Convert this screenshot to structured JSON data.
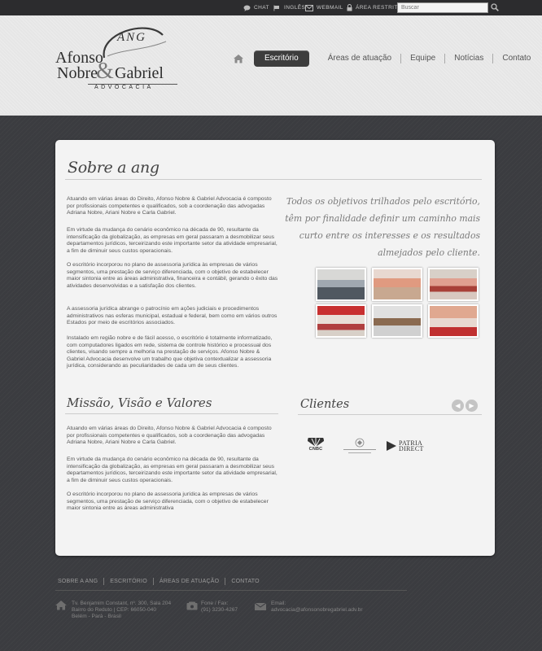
{
  "topbar": {
    "chat": "CHAT",
    "ingles": "INGLÊS",
    "webmail": "WEBMAIL",
    "area_restrita": "ÁREA RESTRITA",
    "search_placeholder": "Buscar"
  },
  "logo": {
    "mark": "ANG",
    "line1": "Afonso",
    "line2": "Nobre",
    "amp": "&",
    "line3": "Gabriel",
    "tagline": "ADVOCACIA"
  },
  "nav": {
    "items": [
      "Escritório",
      "Áreas de atuação",
      "Equipe",
      "Notícias",
      "Contato"
    ]
  },
  "about": {
    "title": "Sobre a ang",
    "paragraphs": [
      "Atuando em várias áreas do Direito, Afonso Nobre & Gabriel Advocacia é composto por profissionais competentes e qualificados, sob a coordenação das advogadas Adriana Nobre, Ariani Nobre e Carla Gabriel.",
      "Em virtude da mudança do cenário econômico na década de 90, resultante da intensificação da globalização, as empresas em geral passaram a desmobilizar seus departamentos jurídicos, terceirizando este importante setor da atividade empresarial, a fim de diminuir seus custos operacionais.",
      "O escritório incorporou no plano de assessoria jurídica às empresas de vários segmentos, uma prestação de serviço diferenciada, com o objetivo de estabelecer maior sintonia entre as áreas administrativa, financeira e contábil, gerando o êxito das atividades desenvolvidas e a satisfação dos clientes.",
      "A assessoria jurídica abrange o patrocínio em ações judiciais e procedimentos administrativos nas esferas municipal, estadual e federal, bem como em vários outros Estados por meio de escritórios associados.",
      "Instalado em região nobre e de fácil acesso, o escritório é totalmente informatizado, com computadores ligados em rede, sistema de controle histórico e processual dos clientes, visando sempre a melhoria na prestação de serviços. Afonso Nobre & Gabriel Advocacia desenvolve um trabalho que objetiva contextualizar a assessoria jurídica, considerando as peculiaridades de cada um de seus clientes."
    ],
    "quote": "Todos os objetivos trilhados pelo escritório, têm por finalidade definir um caminho mais curto entre os interesses e os resultados almejados pelo cliente."
  },
  "mvv": {
    "title": "Missão, Visão e Valores",
    "paragraphs": [
      "Atuando em várias áreas do Direito, Afonso Nobre & Gabriel Advocacia é composto por profissionais competentes e qualificados, sob a coordenação das advogadas Adriana Nobre, Ariani Nobre e Carla Gabriel.",
      "Em virtude da mudança do cenário econômico na década de 90, resultante da intensificação da globalização, as empresas em geral passaram a desmobilizar seus departamentos jurídicos, terceirizando este importante setor da atividade empresarial, a fim de diminuir seus custos operacionais.",
      "O escritório incorporou no plano de assessoria jurídica às empresas de vários segmentos, uma prestação de serviço diferenciada, com o objetivo de estabelecer maior sintonia entre as áreas administrativa"
    ]
  },
  "clients": {
    "title": "Clientes",
    "logos": [
      "CNBC",
      "PATRIA",
      "DIRECT"
    ]
  },
  "footer": {
    "nav": [
      "SOBRE A ANG",
      "ESCRITÓRIO",
      "ÁREAS DE ATUAÇÃO",
      "CONTATO"
    ],
    "address": [
      "Tv. Benjamim Constant, nº. 300, Sala 204",
      "Bairro do Reduto | CEP: 66050-040",
      "Belém - Pará - Brasil"
    ],
    "phone": [
      "Fone / Fax:",
      "(91) 3230-4267"
    ],
    "email": [
      "Email:",
      "advocacia@afonsonobregabriel.adv.br"
    ]
  }
}
